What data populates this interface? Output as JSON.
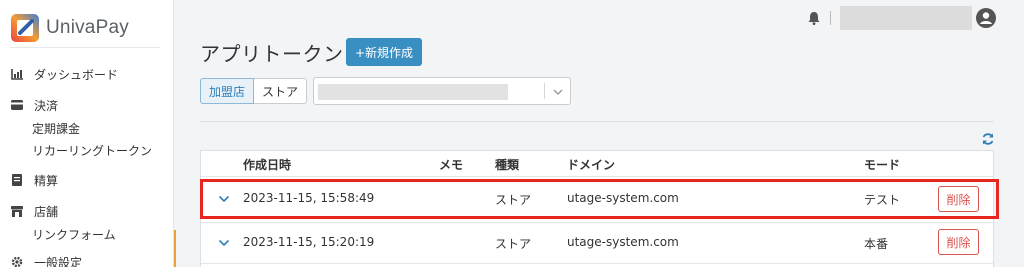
{
  "brand": {
    "name": "UnivaPay"
  },
  "sidebar": {
    "items": [
      {
        "label": "ダッシュボード",
        "icon": "dashboard-icon"
      },
      {
        "label": "決済",
        "icon": "card-icon",
        "children": [
          "定期課金",
          "リカーリングトークン"
        ]
      },
      {
        "label": "精算",
        "icon": "ledger-icon"
      },
      {
        "label": "店舗",
        "icon": "store-icon",
        "children": [
          "リンクフォーム"
        ]
      },
      {
        "label": "一般設定",
        "icon": "gear-icon"
      }
    ]
  },
  "page": {
    "title": "アプリトークン",
    "new_button": "+新規作成",
    "filter": {
      "options": [
        "加盟店",
        "ストア"
      ],
      "selected": "加盟店"
    }
  },
  "table": {
    "headers": {
      "created": "作成日時",
      "memo": "メモ",
      "type": "種類",
      "domain": "ドメイン",
      "mode": "モード"
    },
    "rows": [
      {
        "created": "2023-11-15, 15:58:49",
        "memo": "",
        "type": "ストア",
        "domain": "utage-system.com",
        "mode": "テスト",
        "action": "削除"
      },
      {
        "created": "2023-11-15, 15:20:19",
        "memo": "",
        "type": "ストア",
        "domain": "utage-system.com",
        "mode": "本番",
        "action": "削除"
      }
    ]
  },
  "colors": {
    "accent": "#3a8fc2",
    "danger": "#d9534f",
    "highlight": "#e8261f"
  }
}
